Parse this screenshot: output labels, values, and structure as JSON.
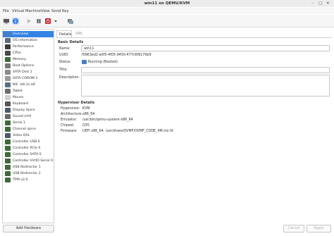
{
  "window": {
    "title": "win11 on QEMU/KVM",
    "minimize_glyph": "–",
    "maximize_glyph": "□",
    "close_glyph": "✕"
  },
  "menu": {
    "items": [
      "File",
      "Virtual Machine",
      "View",
      "Send Key"
    ]
  },
  "toolbar": {
    "icons": [
      "monitor-icon",
      "info-icon",
      "play-icon",
      "pause-icon",
      "power-icon",
      "dropdown-icon",
      "snapshot-icon"
    ]
  },
  "sidebar": {
    "items": [
      {
        "label": "Overview",
        "icon": "overview-icon",
        "color": "#4a7fc1",
        "selected": true
      },
      {
        "label": "OS information",
        "icon": "os-icon",
        "color": "#5e6a78"
      },
      {
        "label": "Performance",
        "icon": "performance-icon",
        "color": "#3b3b3b"
      },
      {
        "label": "CPUs",
        "icon": "cpu-icon",
        "color": "#4a4a4a"
      },
      {
        "label": "Memory",
        "icon": "memory-icon",
        "color": "#3f6b3a"
      },
      {
        "label": "Boot Options",
        "icon": "boot-icon",
        "color": "#777777"
      },
      {
        "label": "SATA Disk 1",
        "icon": "disk-icon",
        "color": "#8a8a8a"
      },
      {
        "label": "SATA CDROM 1",
        "icon": "cdrom-icon",
        "color": "#9a9a9a"
      },
      {
        "label": "NIC :b6:3c:a9",
        "icon": "nic-icon",
        "color": "#5a6e7f"
      },
      {
        "label": "Tablet",
        "icon": "tablet-icon",
        "color": "#6b6b6b"
      },
      {
        "label": "Mouse",
        "icon": "mouse-icon",
        "color": "#cfcfcf"
      },
      {
        "label": "Keyboard",
        "icon": "keyboard-icon",
        "color": "#555555"
      },
      {
        "label": "Display Spice",
        "icon": "display-icon",
        "color": "#4a5a6a"
      },
      {
        "label": "Sound ich9",
        "icon": "sound-icon",
        "color": "#6a6a6a"
      },
      {
        "label": "Serial 1",
        "icon": "serial-icon",
        "color": "#3f6b3a"
      },
      {
        "label": "Channel spice",
        "icon": "channel-icon",
        "color": "#3f6b3a"
      },
      {
        "label": "Video QXL",
        "icon": "video-icon",
        "color": "#4a5a6a"
      },
      {
        "label": "Controller USB 0",
        "icon": "controller-icon",
        "color": "#3f6b3a"
      },
      {
        "label": "Controller PCIe 0",
        "icon": "controller-icon",
        "color": "#3f6b3a"
      },
      {
        "label": "Controller SATA 0",
        "icon": "controller-icon",
        "color": "#3f6b3a"
      },
      {
        "label": "Controller VirtIO Serial 0",
        "icon": "controller-icon",
        "color": "#3f6b3a"
      },
      {
        "label": "USB Redirector 1",
        "icon": "usb-icon",
        "color": "#3f6b3a"
      },
      {
        "label": "USB Redirector 2",
        "icon": "usb-icon",
        "color": "#3f6b3a"
      },
      {
        "label": "TPM v2.0",
        "icon": "tpm-icon",
        "color": "#3f6b3a"
      }
    ]
  },
  "tabs": [
    "Details",
    "XML"
  ],
  "basic": {
    "heading": "Basic Details",
    "name_label": "Name:",
    "name_value": "win11",
    "uuid_label": "UUID:",
    "uuid_value": "f0963ed2-a0f5-4f05-9450-477c6f9170b9",
    "status_label": "Status:",
    "status_value": "Running (Booted)",
    "title_label": "Title:",
    "title_value": "",
    "description_label": "Description:",
    "description_value": ""
  },
  "hypervisor": {
    "heading": "Hypervisor Details",
    "rows": [
      {
        "label": "Hypervisor:",
        "value": "KVM"
      },
      {
        "label": "Architecture:",
        "value": "x86_64"
      },
      {
        "label": "Emulator:",
        "value": "/usr/bin/qemu-system-x86_64"
      },
      {
        "label": "Chipset:",
        "value": "Q35"
      },
      {
        "label": "Firmware:",
        "value": "UEFI x86_64: /usr/share/OVMF/OVMF_CODE_4M.ms.fd"
      }
    ]
  },
  "footer": {
    "add_hardware": "Add Hardware",
    "cancel": "Cancel",
    "apply": "Apply"
  }
}
